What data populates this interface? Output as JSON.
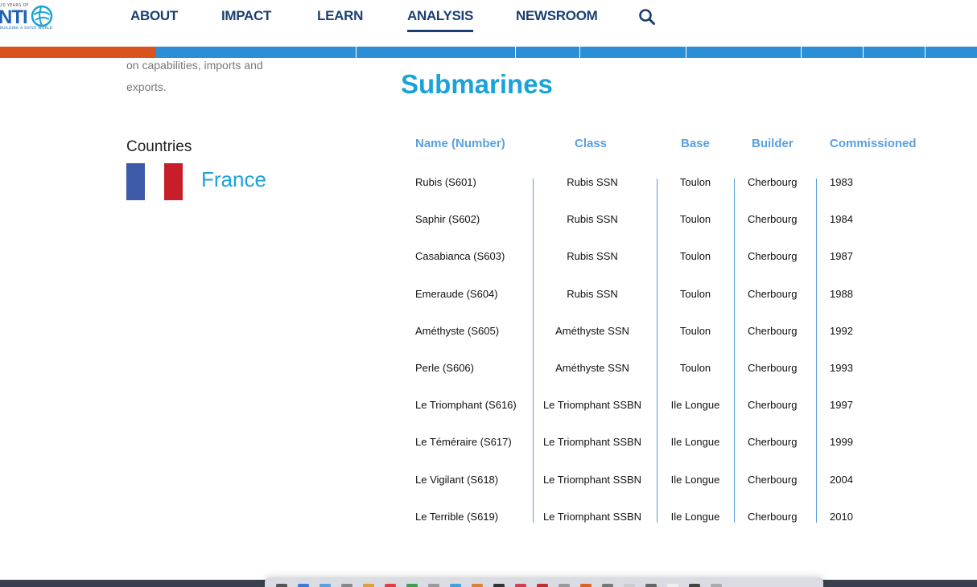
{
  "header": {
    "logo": {
      "top_text": "20 YEARS OF",
      "main_text": "NTI",
      "sub_text": "BUILDING A SAFER WORLD",
      "icon": "globe-icon"
    },
    "nav": [
      {
        "label": "ABOUT",
        "active": false
      },
      {
        "label": "IMPACT",
        "active": false
      },
      {
        "label": "LEARN",
        "active": false
      },
      {
        "label": "ANALYSIS",
        "active": true
      },
      {
        "label": "NEWSROOM",
        "active": false
      }
    ],
    "search_icon": "search-icon",
    "colors": {
      "nav_text": "#1b3f73",
      "accent_blue": "#1aa3d9",
      "accent_orange": "#d9531e"
    }
  },
  "sidebar": {
    "intro_tail": "on capabilities, imports and exports.",
    "countries_heading": "Countries",
    "countries": [
      {
        "name": "France",
        "flag_colors": [
          "#3d5aa8",
          "#ffffff",
          "#c81e2c"
        ]
      }
    ]
  },
  "main": {
    "title": "Submarines",
    "table": {
      "headers": [
        "Name (Number)",
        "Class",
        "Base",
        "Builder",
        "Commissioned"
      ],
      "rows": [
        [
          "Rubis (S601)",
          "Rubis SSN",
          "Toulon",
          "Cherbourg",
          "1983"
        ],
        [
          "Saphir (S602)",
          "Rubis SSN",
          "Toulon",
          "Cherbourg",
          "1984"
        ],
        [
          "Casabianca (S603)",
          "Rubis SSN",
          "Toulon",
          "Cherbourg",
          "1987"
        ],
        [
          "Emeraude (S604)",
          "Rubis SSN",
          "Toulon",
          "Cherbourg",
          "1988"
        ],
        [
          "Améthyste (S605)",
          "Améthyste SSN",
          "Toulon",
          "Cherbourg",
          "1992"
        ],
        [
          "Perle (S606)",
          "Améthyste SSN",
          "Toulon",
          "Cherbourg",
          "1993"
        ],
        [
          "Le Triomphant (S616)",
          "Le Triomphant SSBN",
          "Ile Longue",
          "Cherbourg",
          "1997"
        ],
        [
          "Le Téméraire (S617)",
          "Le Triomphant SSBN",
          "Ile Longue",
          "Cherbourg",
          "1999"
        ],
        [
          "Le Vigilant (S618)",
          "Le Triomphant SSBN",
          "Ile Longue",
          "Cherbourg",
          "2004"
        ],
        [
          "Le Terrible (S619)",
          "Le Triomphant SSBN",
          "Ile Longue",
          "Cherbourg",
          "2010"
        ]
      ],
      "header_color": "#5aa0e0"
    }
  }
}
